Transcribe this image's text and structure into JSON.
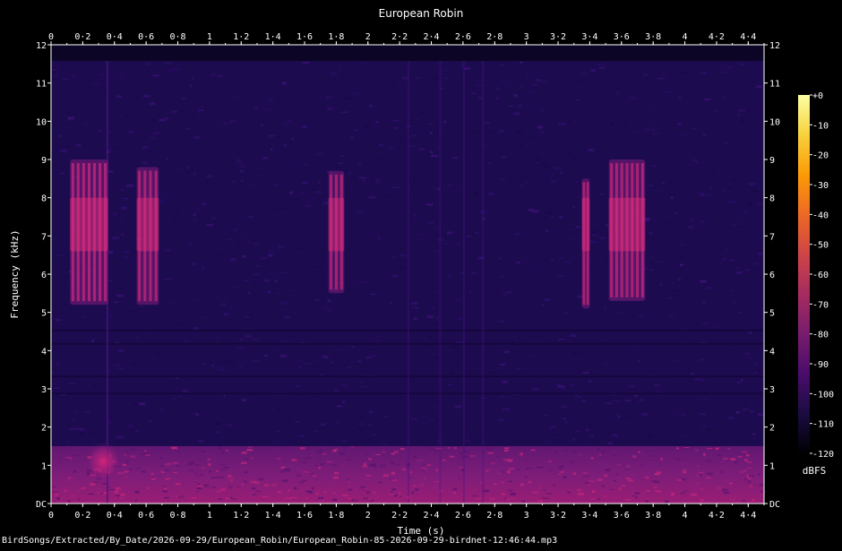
{
  "chart_data": {
    "type": "heatmap",
    "title": "European Robin",
    "xlabel": "Time (s)",
    "ylabel": "Frequency (kHz)",
    "xlim": [
      0,
      4.5
    ],
    "ylim": [
      0,
      12
    ],
    "x_ticks": [
      "0",
      "0·2",
      "0·4",
      "0·6",
      "0·8",
      "1",
      "1·2",
      "1·4",
      "1·6",
      "1·8",
      "2",
      "2·2",
      "2·4",
      "2·6",
      "2·8",
      "3",
      "3·2",
      "3·4",
      "3·6",
      "3·8",
      "4",
      "4·2",
      "4·4"
    ],
    "y_ticks": [
      "DC",
      "1",
      "2",
      "3",
      "4",
      "5",
      "6",
      "7",
      "8",
      "9",
      "10",
      "11",
      "12"
    ],
    "colorbar": {
      "label": "dBFS",
      "range": [
        -120,
        0
      ],
      "ticks": [
        "+0",
        "-10",
        "-20",
        "-30",
        "-40",
        "-50",
        "-60",
        "-70",
        "-80",
        "-90",
        "-100",
        "-110",
        "-120"
      ],
      "colormap": [
        "#000004",
        "#1b0c41",
        "#4a0c6b",
        "#781c6d",
        "#a52c60",
        "#cf4446",
        "#ed6925",
        "#fb9b06",
        "#f7d13d",
        "#fcffa4"
      ]
    },
    "background_level_dbfs": -100,
    "sound_events": [
      {
        "t_start": 0.12,
        "t_end": 0.36,
        "f_low_khz": 5.2,
        "f_high_khz": 9.0,
        "peak_dbfs": -65
      },
      {
        "t_start": 0.54,
        "t_end": 0.68,
        "f_low_khz": 5.2,
        "f_high_khz": 8.8,
        "peak_dbfs": -67
      },
      {
        "t_start": 1.75,
        "t_end": 1.85,
        "f_low_khz": 5.5,
        "f_high_khz": 8.7,
        "peak_dbfs": -70
      },
      {
        "t_start": 3.35,
        "t_end": 3.4,
        "f_low_khz": 5.1,
        "f_high_khz": 8.5,
        "peak_dbfs": -70
      },
      {
        "t_start": 3.52,
        "t_end": 3.75,
        "f_low_khz": 5.3,
        "f_high_khz": 9.0,
        "peak_dbfs": -67
      }
    ],
    "low_frequency_band": {
      "f_low_khz": 0,
      "f_high_khz": 1.5,
      "level_dbfs": -80
    }
  },
  "caption": "BirdSongs/Extracted/By_Date/2026-09-29/European_Robin/European_Robin-85-2026-09-29-birdnet-12:46:44.mp3"
}
